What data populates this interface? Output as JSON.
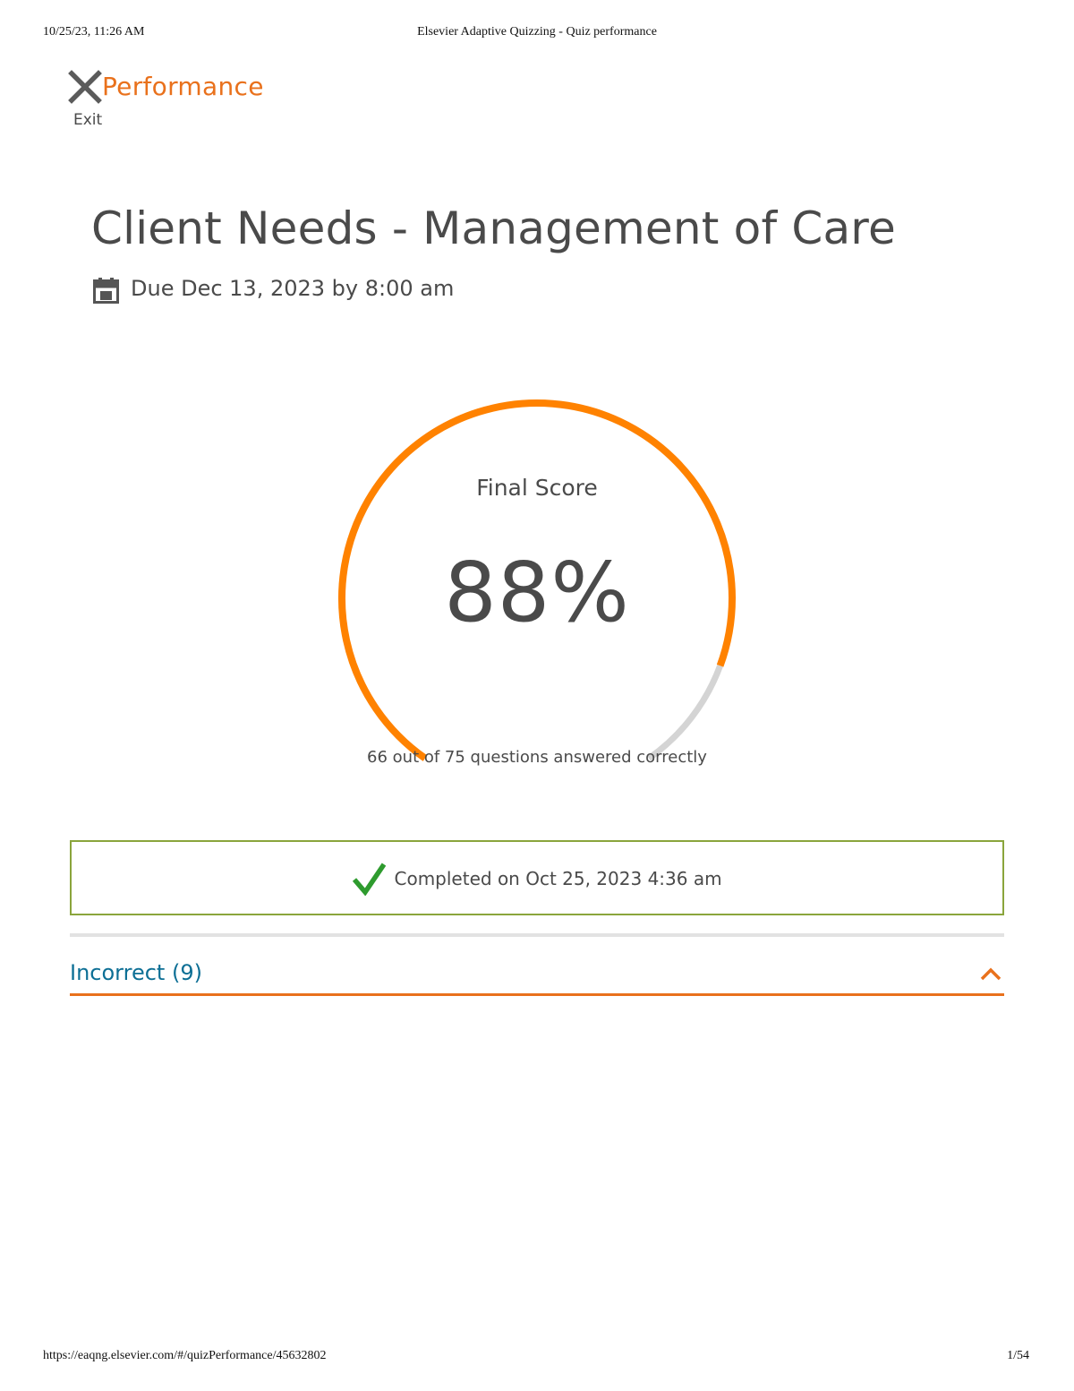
{
  "print_header": {
    "datetime": "10/25/23, 11:26 AM",
    "page_title": "Elsevier Adaptive Quizzing - Quiz performance"
  },
  "header": {
    "title": "Performance",
    "exit_label": "Exit",
    "exit_icon": "close-icon"
  },
  "quiz": {
    "title": "Client Needs - Management of Care",
    "due_icon": "calendar-icon",
    "due": "Due Dec 13, 2023 by 8:00 am"
  },
  "score": {
    "label": "Final Score",
    "value": "88%",
    "percent": 88,
    "caption": "66 out of 75 questions answered correctly"
  },
  "completion": {
    "icon": "checkmark-icon",
    "text": "Completed on Oct 25, 2023 4:36 am"
  },
  "section": {
    "label": "Incorrect (9)",
    "expanded": true,
    "toggle_icon": "chevron-up-icon"
  },
  "print_footer": {
    "url": "https://eaqng.elsevier.com/#/quizPerformance/45632802",
    "page": "1/54"
  },
  "colors": {
    "accent": "#e9711c",
    "gauge_fill": "#ff8200",
    "gauge_track": "#d4d4d4",
    "success_border": "#8aa53c",
    "check": "#2e9b2e",
    "section_label": "#0d6f95",
    "text": "#4a4a4a"
  }
}
